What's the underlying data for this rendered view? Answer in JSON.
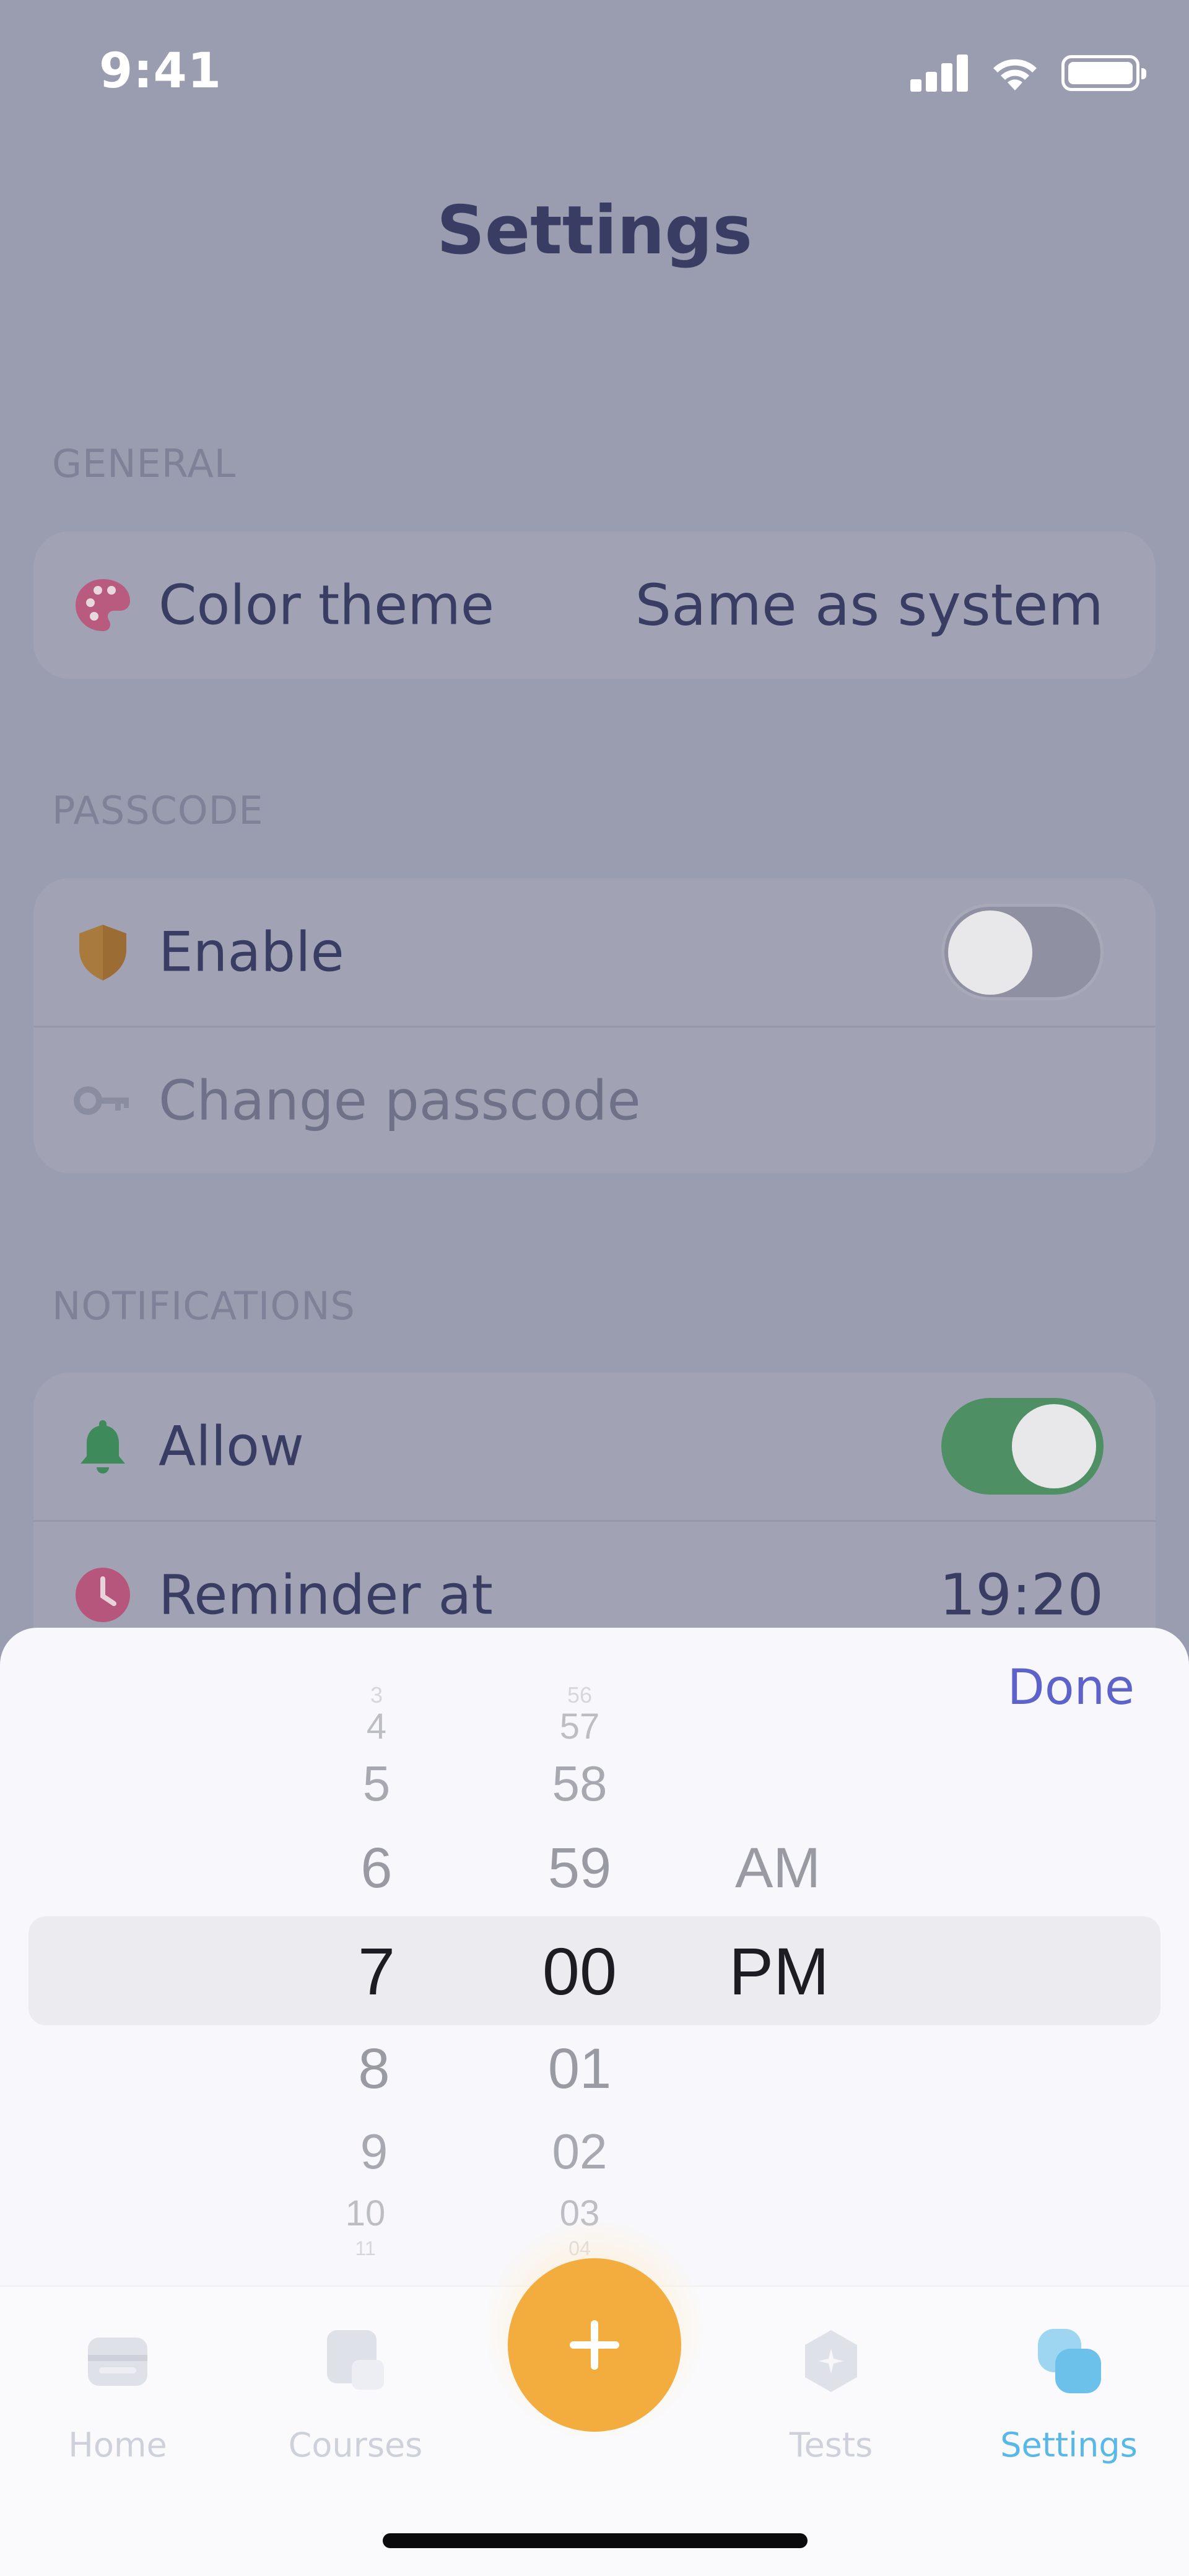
{
  "status_bar": {
    "time": "9:41"
  },
  "page_title": "Settings",
  "general": {
    "title": "GENERAL",
    "color_theme": {
      "label": "Color theme",
      "value": "Same as system"
    }
  },
  "passcode": {
    "title": "PASSCODE",
    "enable": {
      "label": "Enable",
      "toggle_on": false
    },
    "change": {
      "label": "Change passcode"
    }
  },
  "notifications": {
    "title": "NOTIFICATIONS",
    "allow": {
      "label": "Allow",
      "toggle_on": true
    },
    "reminder": {
      "label": "Reminder at",
      "value": "19:20"
    }
  },
  "picker": {
    "done_label": "Done",
    "hours": [
      "3",
      "4",
      "5",
      "6",
      "7",
      "8",
      "9",
      "10",
      "11"
    ],
    "minutes": [
      "56",
      "57",
      "58",
      "59",
      "00",
      "01",
      "02",
      "03",
      "04"
    ],
    "periods": [
      "AM",
      "PM"
    ],
    "selected": {
      "hour": "7",
      "minute": "00",
      "period": "PM"
    }
  },
  "tabbar": {
    "home": "Home",
    "courses": "Courses",
    "tests": "Tests",
    "settings": "Settings",
    "active": "settings"
  },
  "colors": {
    "accent_orange": "#f3ad3f",
    "active_tab": "#5ab8e6",
    "toggle_on": "#4e8f63",
    "done_text": "#5d63c9",
    "title_text": "#3a3d63"
  }
}
